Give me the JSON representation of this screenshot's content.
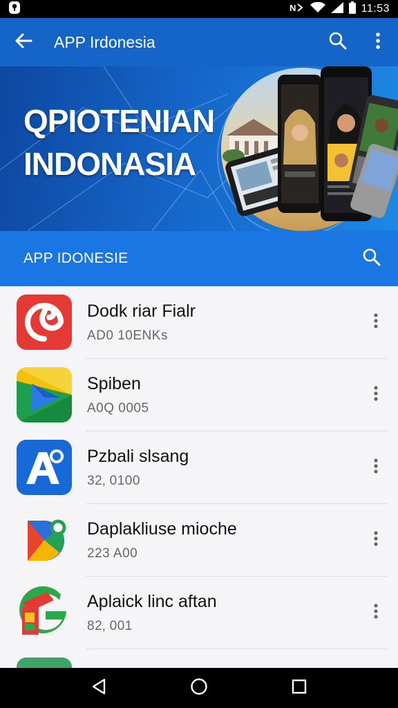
{
  "status_bar": {
    "time": "11:53",
    "left_icon": "notification-icon",
    "icons": [
      "nfc-icon",
      "wifi-icon",
      "signal-icon",
      "battery-icon"
    ]
  },
  "app_bar": {
    "title": "APP Irdonesia",
    "icons": [
      "back-arrow-icon",
      "search-icon",
      "more-vert-icon"
    ]
  },
  "banner": {
    "title_line1": "QPIOTENIAN",
    "title_line2": "INDONASIA"
  },
  "section": {
    "title": "APP IDONESIE",
    "icon": "search-icon"
  },
  "apps": [
    {
      "name": "Dodk riar Fialr",
      "meta": "AD0 10ENKs",
      "icon": "app-icon-red-swirl"
    },
    {
      "name": "Spiben",
      "meta": "A0Q 0005",
      "icon": "app-icon-play-triangle"
    },
    {
      "name": "Pzbali slsang",
      "meta": "32‚ 0100",
      "icon": "app-icon-blue-a"
    },
    {
      "name": "Daplakliuse mioche",
      "meta": "223 A00",
      "icon": "app-icon-colorful-d"
    },
    {
      "name": "Aplaick linc aftan",
      "meta": "82‚ 001",
      "icon": "app-icon-green-g"
    }
  ],
  "nav_bar": {
    "icons": [
      "back-triangle-icon",
      "home-circle-icon",
      "recents-square-icon"
    ]
  },
  "colors": {
    "app_bar": "#1565c8",
    "section_bar": "#1976e3",
    "list_bg": "#f5f5f7",
    "status_bar": "#000000"
  }
}
